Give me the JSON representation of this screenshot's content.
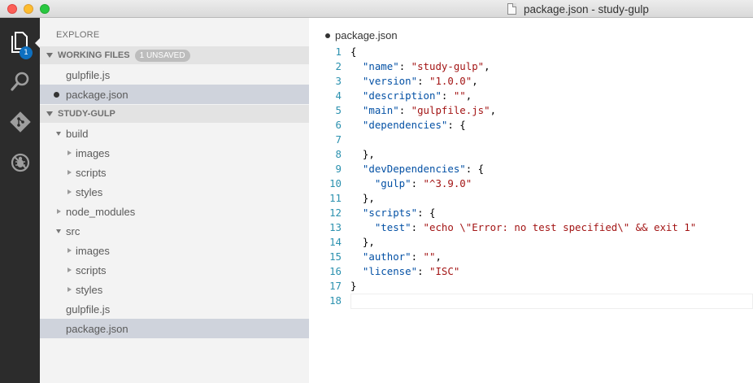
{
  "window": {
    "title": "package.json - study-gulp"
  },
  "activity_bar": {
    "items": [
      {
        "name": "explorer",
        "icon": "files-icon",
        "badge": "1"
      },
      {
        "name": "search",
        "icon": "search-icon"
      },
      {
        "name": "git",
        "icon": "git-icon"
      },
      {
        "name": "debug",
        "icon": "debug-icon"
      }
    ]
  },
  "sidebar": {
    "header": "EXPLORE",
    "working_files": {
      "label": "WORKING FILES",
      "badge": "1 UNSAVED",
      "files": [
        "gulpfile.js",
        "package.json"
      ]
    },
    "project": {
      "label": "STUDY-GULP",
      "tree": [
        {
          "label": "build"
        },
        {
          "label": "images"
        },
        {
          "label": "scripts"
        },
        {
          "label": "styles"
        },
        {
          "label": "node_modules"
        },
        {
          "label": "src"
        },
        {
          "label": "images"
        },
        {
          "label": "scripts"
        },
        {
          "label": "styles"
        },
        {
          "label": "gulpfile.js"
        },
        {
          "label": "package.json"
        }
      ]
    }
  },
  "editor": {
    "tab_title": "package.json",
    "lines": [
      {
        "n": "1",
        "parts": [
          {
            "t": "{",
            "c": "p"
          }
        ]
      },
      {
        "n": "2",
        "parts": [
          {
            "t": "  ",
            "c": "p"
          },
          {
            "t": "\"name\"",
            "c": "k"
          },
          {
            "t": ": ",
            "c": "p"
          },
          {
            "t": "\"study-gulp\"",
            "c": "s"
          },
          {
            "t": ",",
            "c": "p"
          }
        ]
      },
      {
        "n": "3",
        "parts": [
          {
            "t": "  ",
            "c": "p"
          },
          {
            "t": "\"version\"",
            "c": "k"
          },
          {
            "t": ": ",
            "c": "p"
          },
          {
            "t": "\"1.0.0\"",
            "c": "s"
          },
          {
            "t": ",",
            "c": "p"
          }
        ]
      },
      {
        "n": "4",
        "parts": [
          {
            "t": "  ",
            "c": "p"
          },
          {
            "t": "\"description\"",
            "c": "k"
          },
          {
            "t": ": ",
            "c": "p"
          },
          {
            "t": "\"\"",
            "c": "s"
          },
          {
            "t": ",",
            "c": "p"
          }
        ]
      },
      {
        "n": "5",
        "parts": [
          {
            "t": "  ",
            "c": "p"
          },
          {
            "t": "\"main\"",
            "c": "k"
          },
          {
            "t": ": ",
            "c": "p"
          },
          {
            "t": "\"gulpfile.js\"",
            "c": "s"
          },
          {
            "t": ",",
            "c": "p"
          }
        ]
      },
      {
        "n": "6",
        "parts": [
          {
            "t": "  ",
            "c": "p"
          },
          {
            "t": "\"dependencies\"",
            "c": "k"
          },
          {
            "t": ": {",
            "c": "p"
          }
        ]
      },
      {
        "n": "7",
        "parts": [
          {
            "t": "",
            "c": "p"
          }
        ]
      },
      {
        "n": "8",
        "parts": [
          {
            "t": "  },",
            "c": "p"
          }
        ]
      },
      {
        "n": "9",
        "parts": [
          {
            "t": "  ",
            "c": "p"
          },
          {
            "t": "\"devDependencies\"",
            "c": "k"
          },
          {
            "t": ": {",
            "c": "p"
          }
        ]
      },
      {
        "n": "10",
        "parts": [
          {
            "t": "    ",
            "c": "p"
          },
          {
            "t": "\"gulp\"",
            "c": "k"
          },
          {
            "t": ": ",
            "c": "p"
          },
          {
            "t": "\"^3.9.0\"",
            "c": "s"
          }
        ]
      },
      {
        "n": "11",
        "parts": [
          {
            "t": "  },",
            "c": "p"
          }
        ]
      },
      {
        "n": "12",
        "parts": [
          {
            "t": "  ",
            "c": "p"
          },
          {
            "t": "\"scripts\"",
            "c": "k"
          },
          {
            "t": ": {",
            "c": "p"
          }
        ]
      },
      {
        "n": "13",
        "parts": [
          {
            "t": "    ",
            "c": "p"
          },
          {
            "t": "\"test\"",
            "c": "k"
          },
          {
            "t": ": ",
            "c": "p"
          },
          {
            "t": "\"echo \\\"Error: no test specified\\\" && exit 1\"",
            "c": "s"
          }
        ]
      },
      {
        "n": "14",
        "parts": [
          {
            "t": "  },",
            "c": "p"
          }
        ]
      },
      {
        "n": "15",
        "parts": [
          {
            "t": "  ",
            "c": "p"
          },
          {
            "t": "\"author\"",
            "c": "k"
          },
          {
            "t": ": ",
            "c": "p"
          },
          {
            "t": "\"\"",
            "c": "s"
          },
          {
            "t": ",",
            "c": "p"
          }
        ]
      },
      {
        "n": "16",
        "parts": [
          {
            "t": "  ",
            "c": "p"
          },
          {
            "t": "\"license\"",
            "c": "k"
          },
          {
            "t": ": ",
            "c": "p"
          },
          {
            "t": "\"ISC\"",
            "c": "s"
          }
        ]
      },
      {
        "n": "17",
        "parts": [
          {
            "t": "}",
            "c": "p"
          }
        ]
      },
      {
        "n": "18",
        "parts": [
          {
            "t": "",
            "c": "p"
          }
        ]
      }
    ]
  },
  "colors": {
    "activity_bar": "#2c2c2c",
    "sidebar": "#f3f3f3",
    "selection": "#cfd3dc",
    "badge": "#0e70c0",
    "json_key": "#0451a5",
    "json_string": "#a31515",
    "line_number": "#2b91af"
  }
}
